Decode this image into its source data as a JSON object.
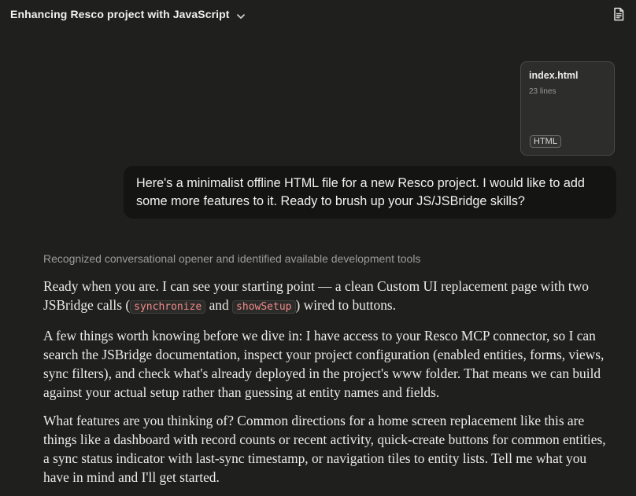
{
  "header": {
    "title": "Enhancing Resco project with JavaScript",
    "title_icon": "chevron-down-icon",
    "doc_icon": "document-icon"
  },
  "attachment": {
    "filename": "index.html",
    "lines": "23 lines",
    "badge": "HTML"
  },
  "user_message": {
    "text": "Here's a minimalist offline HTML file for a new Resco project. I would like to add some more features to it. Ready to brush up your JS/JSBridge skills?"
  },
  "assistant": {
    "thinking_summary": "Recognized conversational opener and identified available development tools",
    "p1_a": "Ready when you are. I can see your starting point — a clean Custom UI replacement page with two JSBridge calls (",
    "p1_code1": "synchronize",
    "p1_b": " and ",
    "p1_code2": "showSetup",
    "p1_c": ") wired to buttons.",
    "p2": "A few things worth knowing before we dive in: I have access to your Resco MCP connector, so I can search the JSBridge documentation, inspect your project configuration (enabled entities, forms, views, sync filters), and check what's already deployed in the project's www folder. That means we can build against your actual setup rather than guessing at entity names and fields.",
    "p3": "What features are you thinking of? Common directions for a home screen replacement like this are things like a dashboard with record counts or recent activity, quick-create buttons for common entities, a sync status indicator with last-sync timestamp, or navigation tiles to entity lists. Tell me what you have in mind and I'll get started."
  },
  "colors": {
    "background": "#1f1f1d",
    "user_bubble": "#141413",
    "code_text": "#f08a8a",
    "muted_text": "#9d9c96"
  }
}
